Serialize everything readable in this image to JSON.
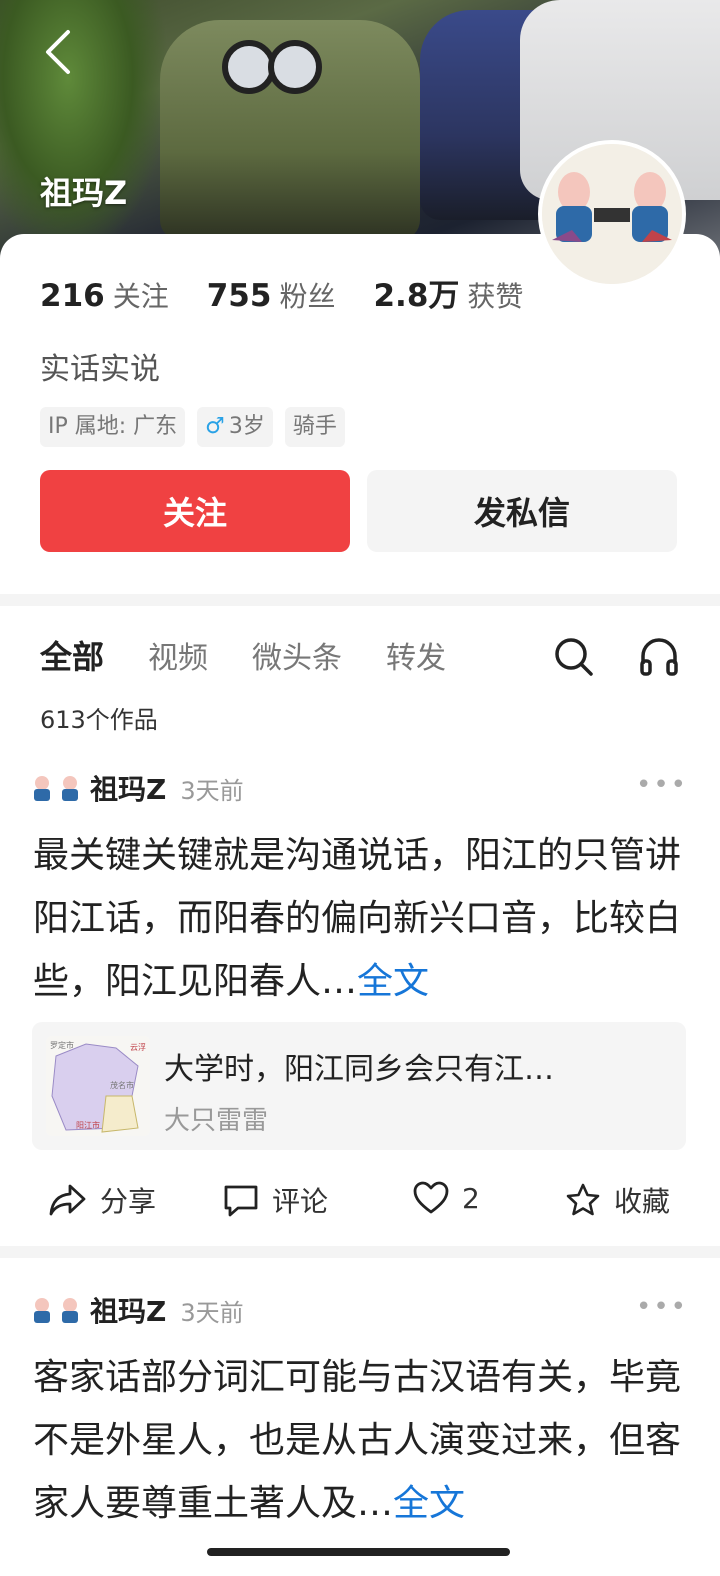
{
  "header": {
    "name": "祖玛Z"
  },
  "profile": {
    "stats": [
      {
        "value": "216",
        "label": "关注"
      },
      {
        "value": "755",
        "label": "粉丝"
      },
      {
        "value": "2.8万",
        "label": "获赞"
      }
    ],
    "bio": "实话实说",
    "tags": {
      "ip": "IP 属地: 广东",
      "age": "3岁",
      "role": "骑手"
    },
    "follow_label": "关注",
    "message_label": "发私信"
  },
  "tabs": [
    "全部",
    "视频",
    "微头条",
    "转发"
  ],
  "work_count": "613个作品",
  "posts": [
    {
      "author": "祖玛Z",
      "time": "3天前",
      "text": "最关键关键就是沟通说话，阳江的只管讲阳江话，而阳春的偏向新兴口音，比较白些，阳江见阳春人…",
      "more_label": "全文",
      "quote": {
        "title": "大学时，阳江同乡会只有江…",
        "author": "大只雷雷",
        "map_labels": [
          "罗定市",
          "云浮",
          "阳江市",
          "茂名市"
        ]
      },
      "actions": {
        "share": "分享",
        "comment": "评论",
        "likes": "2",
        "collect": "收藏"
      }
    },
    {
      "author": "祖玛Z",
      "time": "3天前",
      "text": "客家话部分词汇可能与古汉语有关，毕竟不是外星人，也是从古人演变过来，但客家人要尊重土著人及…",
      "more_label": "全文"
    }
  ],
  "colors": {
    "accent": "#f04142",
    "link": "#1676d8"
  }
}
